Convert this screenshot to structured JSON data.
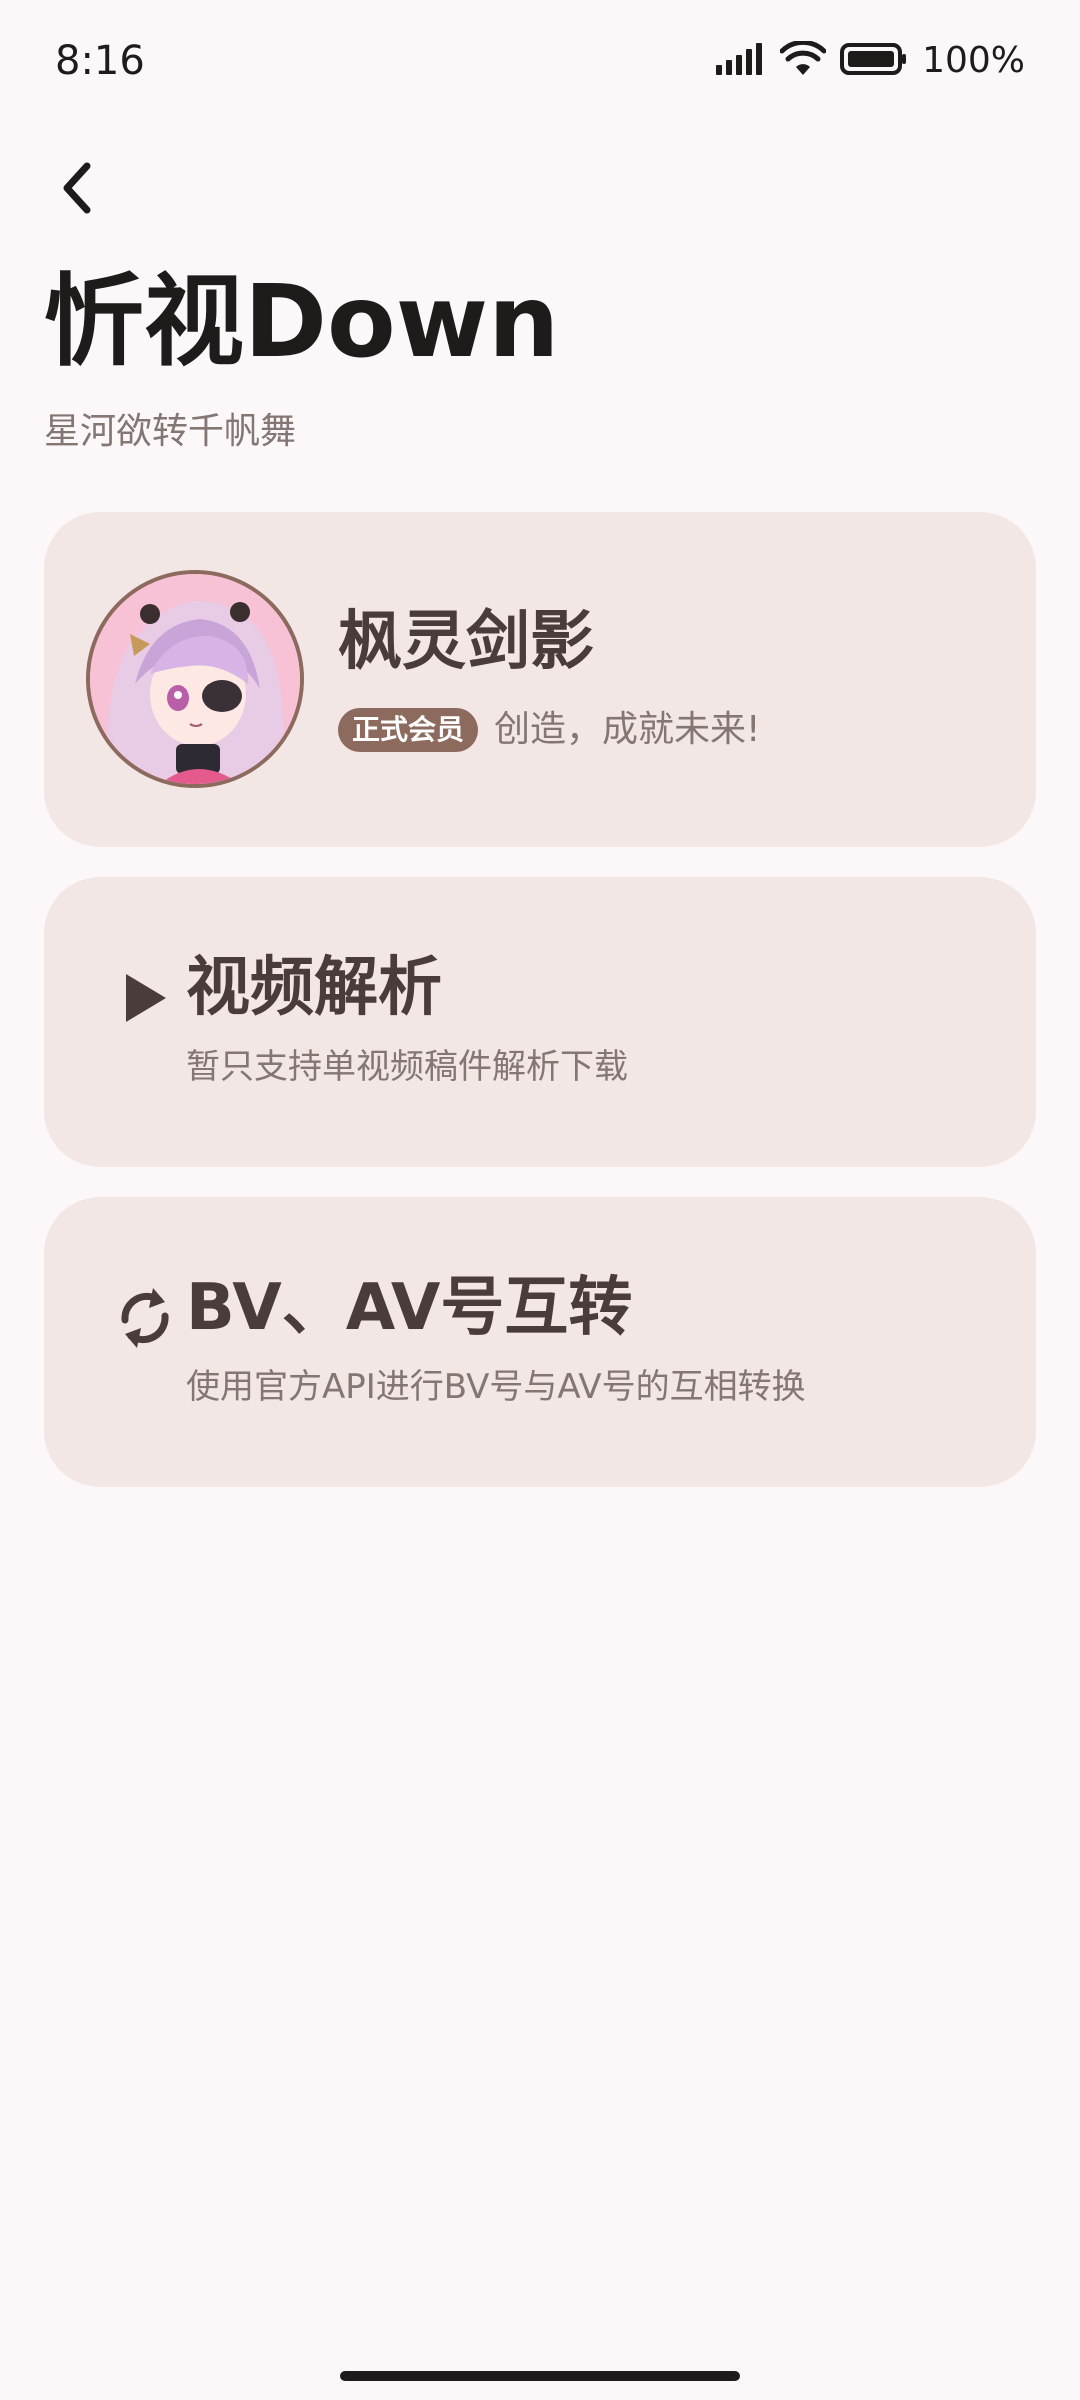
{
  "status_bar": {
    "time": "8:16",
    "battery_text": "100%",
    "icons": [
      "signal-icon",
      "wifi-icon",
      "battery-icon"
    ]
  },
  "header": {
    "back_icon": "chevron-left-icon",
    "title": "忻视Down",
    "subtitle": "星河欲转千帆舞"
  },
  "user_card": {
    "name": "枫灵剑影",
    "badge": "正式会员",
    "motto": "创造，成就未来!"
  },
  "features": [
    {
      "icon": "play-icon",
      "title": "视频解析",
      "description": "暂只支持单视频稿件解析下载"
    },
    {
      "icon": "refresh-icon",
      "title": "BV、AV号互转",
      "description": "使用官方API进行BV号与AV号的互相转换"
    }
  ],
  "colors": {
    "background": "#fcf8fa",
    "card": "#f2e7e4",
    "accent": "#8c6a5d",
    "text_primary": "#1f1b1b",
    "text_secondary": "#837673"
  }
}
